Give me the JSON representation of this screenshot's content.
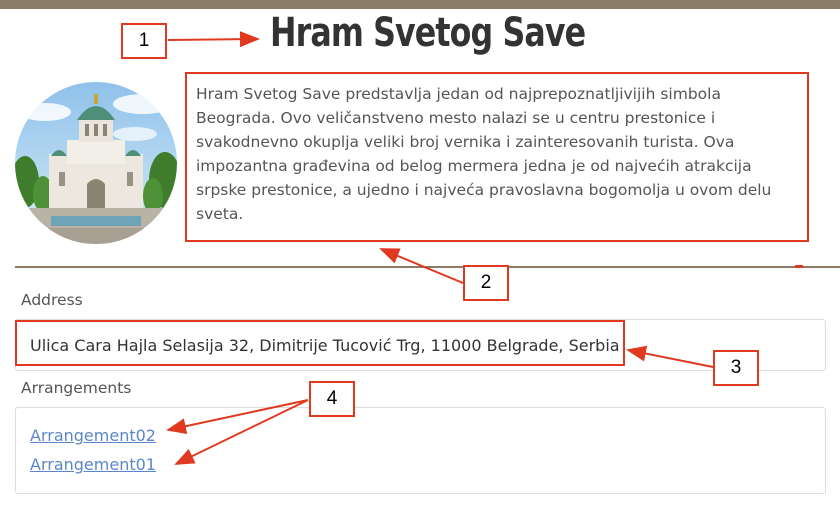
{
  "page": {
    "title": "Hram Svetog Save",
    "description": "Hram Svetog Save predstavlja jedan od najprepoznatljivijih simbola Beograda. Ovo veličanstveno mesto nalazi se u centru prestonice i svakodnevno okuplja veliki broj vernika i zainteresovanih turista. Ova impozantna građevina od belog mermera jedna je od najvećih atrakcija srpske prestonice, a ujedno i najveća pravoslavna bogomolja u ovom delu sveta."
  },
  "address": {
    "label": "Address",
    "value": "Ulica Cara Hajla Selasija 32, Dimitrije Tucović Trg, 11000 Belgrade, Serbia"
  },
  "arrangements": {
    "label": "Arrangements",
    "items": [
      "Arrangement02",
      "Arrangement01"
    ]
  },
  "callouts": [
    "1",
    "2",
    "3",
    "4"
  ],
  "colors": {
    "accent": "#8b7c6a",
    "annotation": "#e0391f",
    "link": "#5b86c9"
  }
}
